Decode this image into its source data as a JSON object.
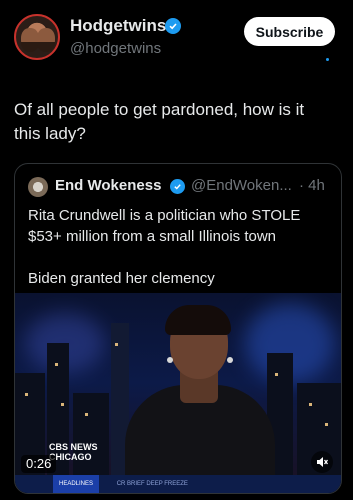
{
  "author": {
    "name": "Hodgetwins",
    "handle": "@hodgetwins",
    "subscribe_label": "Subscribe"
  },
  "tweet": {
    "text": "Of all people to get pardoned, how is it this lady?"
  },
  "quote": {
    "name": "End Wokeness",
    "handle": "@EndWoken...",
    "time": "· 4h",
    "line1": "Rita Crundwell is a politician who STOLE $53+ million from a small Illinois town",
    "line2": "Biden granted her clemency"
  },
  "video": {
    "network_logo": "CBS NEWS",
    "location": "CHICAGO",
    "duration": "0:26",
    "ticker_headline": "HEADLINES",
    "ticker_text": "CR BRIEF DEEP FREEZE"
  },
  "colors": {
    "background": "#000000",
    "verified": "#1d9bf0",
    "muted": "#71767b"
  },
  "icons": {
    "verified": "verified-badge-icon",
    "mute": "mute-icon"
  }
}
